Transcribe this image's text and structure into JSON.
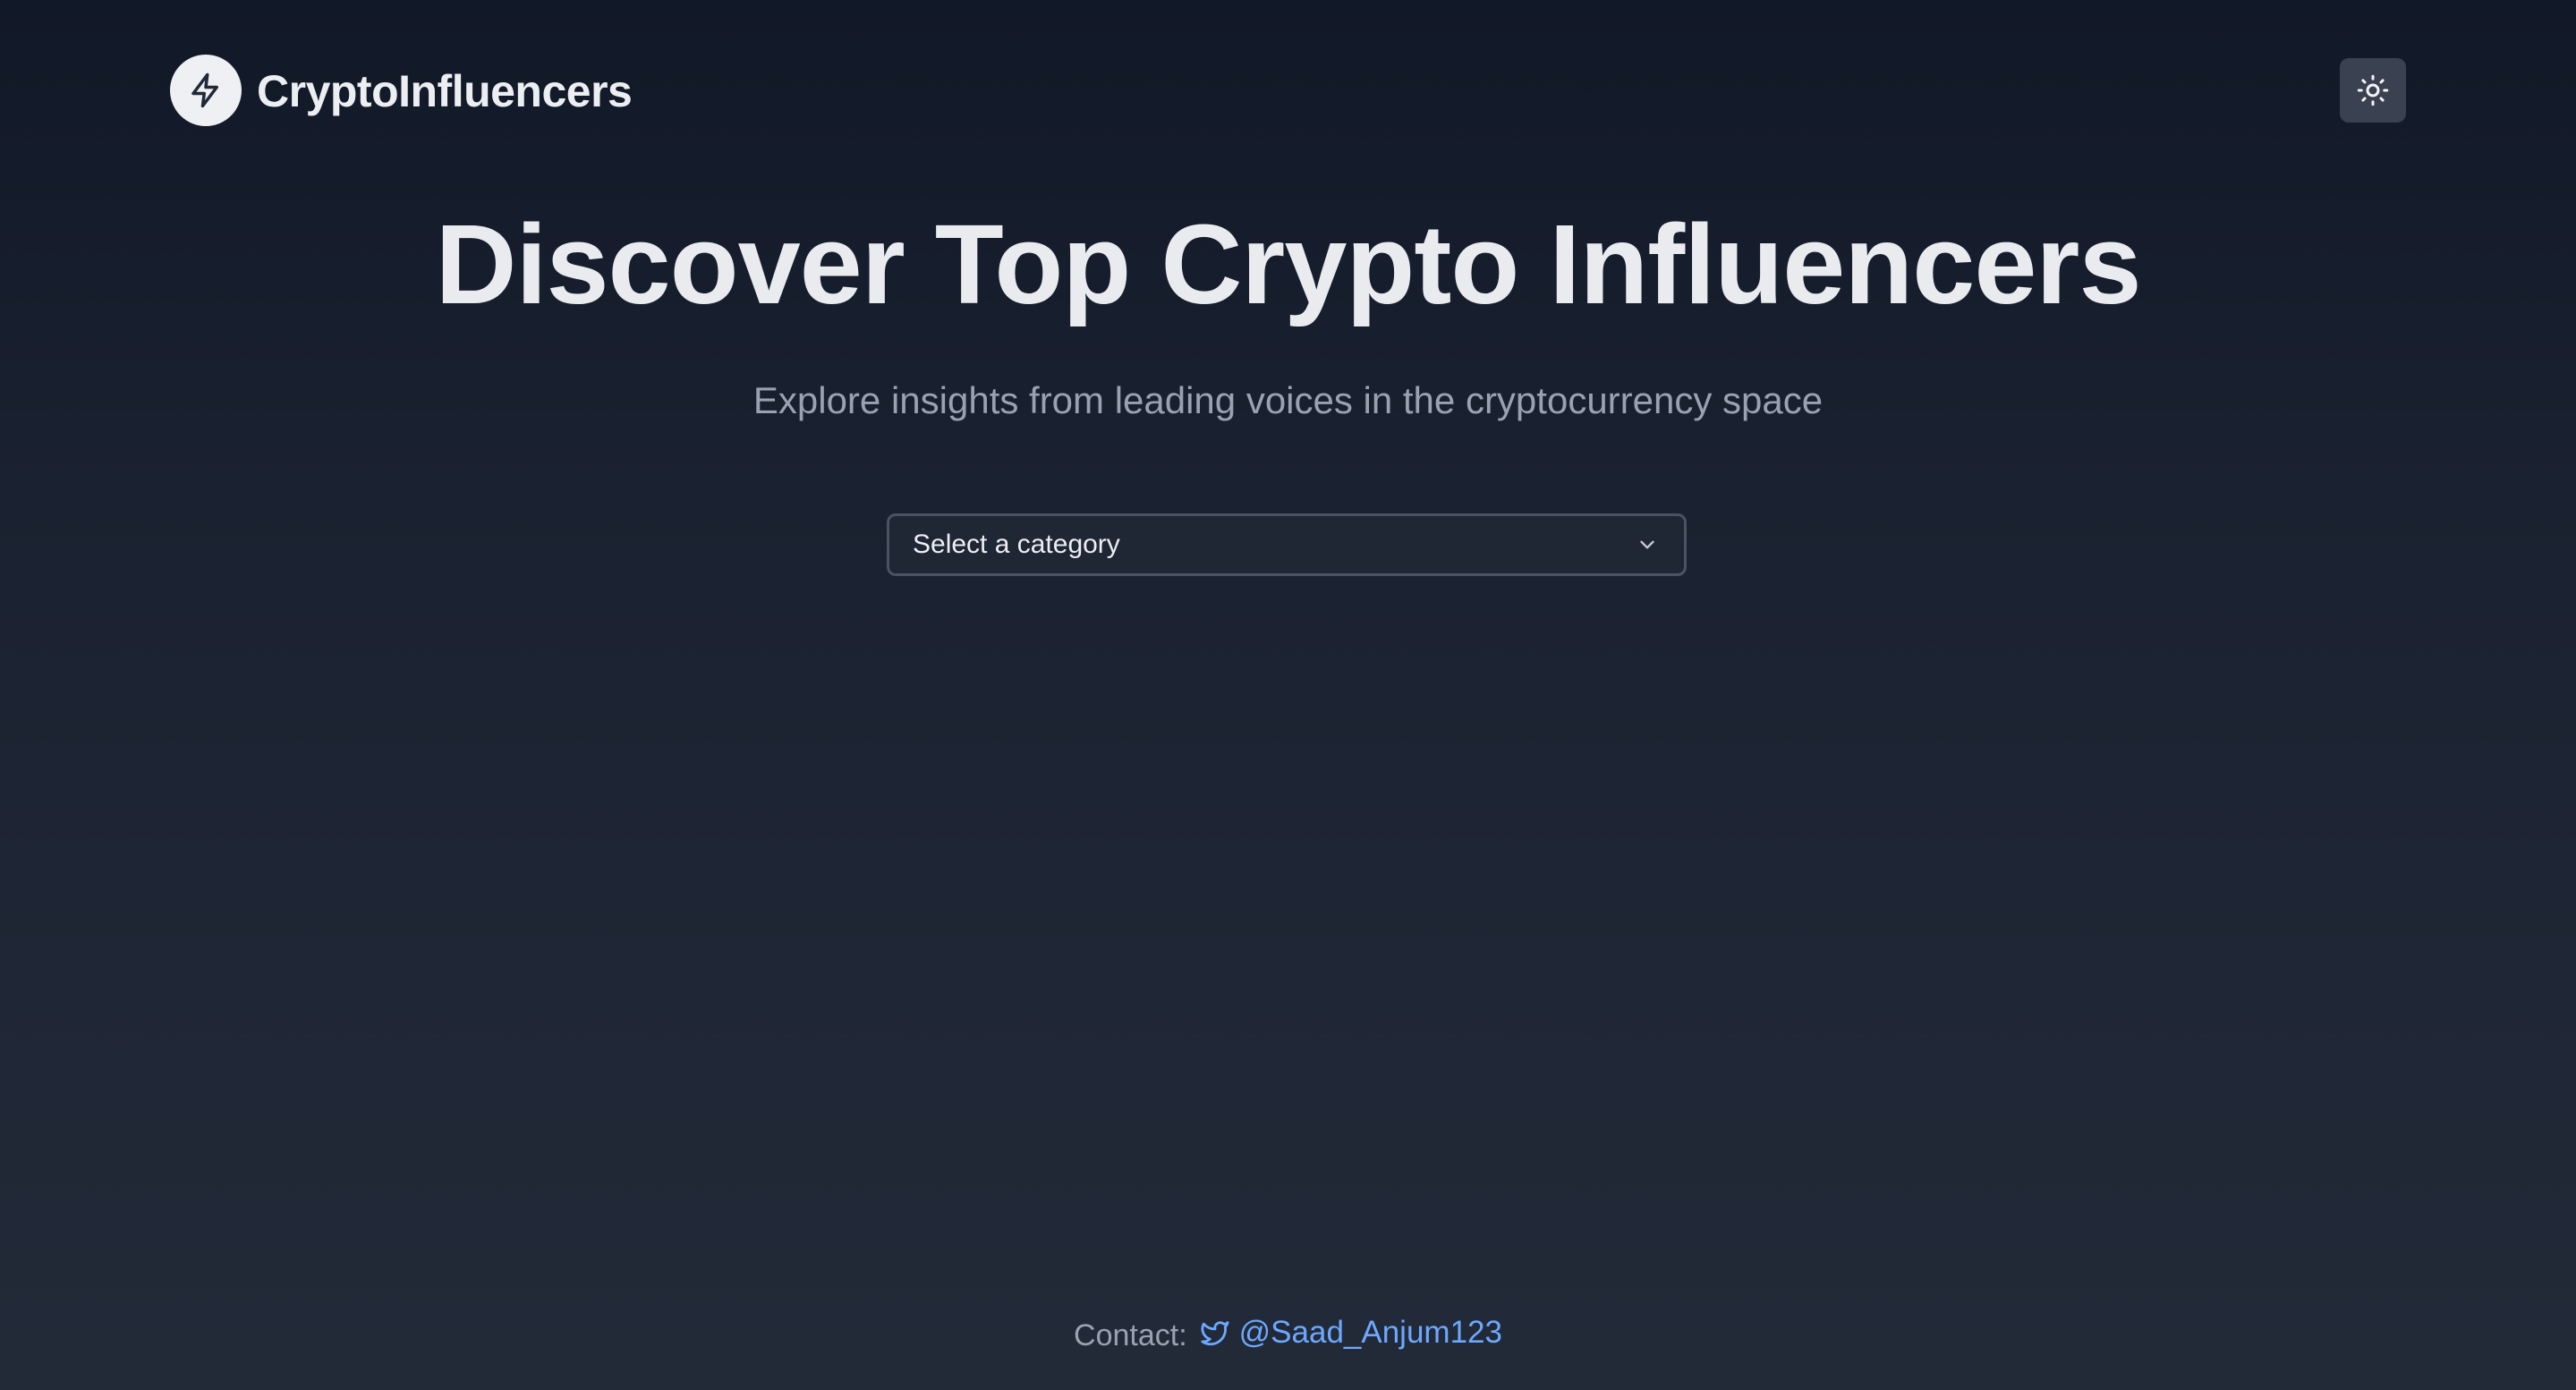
{
  "header": {
    "brand": "CryptoInfluencers",
    "logo_icon": "lightning-bolt-icon",
    "theme_toggle_icon": "sun-icon"
  },
  "hero": {
    "title": "Discover Top Crypto Influencers",
    "subtitle": "Explore insights from leading voices in the cryptocurrency space"
  },
  "category_select": {
    "value": "Select a category",
    "icon": "chevron-down-icon"
  },
  "footer": {
    "contact_label": "Contact:",
    "twitter_icon": "twitter-icon",
    "twitter_handle": "@Saad_Anjum123"
  },
  "colors": {
    "background_top": "#111827",
    "background_bottom": "#222a38",
    "text_primary": "#e9ebef",
    "text_muted": "#9aa2b1",
    "link": "#6ea8fe",
    "border": "#4b5362"
  }
}
